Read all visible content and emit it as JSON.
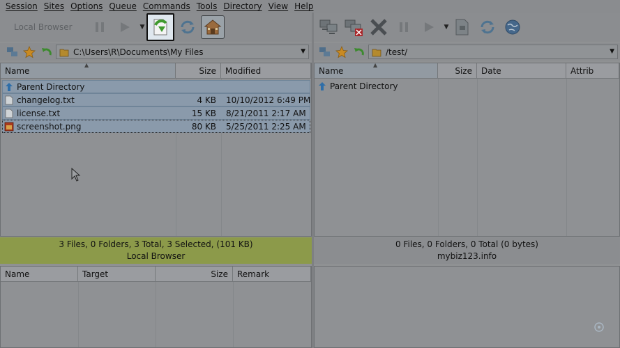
{
  "menu": [
    "Session",
    "Sites",
    "Options",
    "Queue",
    "Commands",
    "Tools",
    "Directory",
    "View",
    "Help"
  ],
  "toolbar": {
    "local_label": "Local Browser"
  },
  "icons": {
    "connect": "connect-icon",
    "disconnect": "disconnect-icon",
    "stop": "stop-icon",
    "pause": "pause-icon",
    "play": "play-icon",
    "download": "download-icon",
    "refresh": "refresh-icon",
    "home": "home-icon",
    "globe": "globe-icon",
    "star": "star-icon",
    "back": "back-arrow-icon",
    "folder": "folder-icon",
    "parent": "parent-directory-icon",
    "text_file": "text-file-icon",
    "image_file": "image-file-icon"
  },
  "local": {
    "path": "C:\\Users\\R\\Documents\\My Files",
    "columns": [
      "Name",
      "Size",
      "Modified"
    ],
    "parent_label": "Parent Directory",
    "files": [
      {
        "name": "changelog.txt",
        "size": "4 KB",
        "modified": "10/10/2012 6:49 PM",
        "kind": "text"
      },
      {
        "name": "license.txt",
        "size": "15 KB",
        "modified": "8/21/2011 2:17 AM",
        "kind": "text"
      },
      {
        "name": "screenshot.png",
        "size": "80 KB",
        "modified": "5/25/2011 2:25 AM",
        "kind": "image"
      }
    ],
    "status_line1": "3 Files, 0 Folders, 3 Total, 3 Selected, (101 KB)",
    "status_line2": "Local Browser"
  },
  "remote": {
    "path": "/test/",
    "columns": [
      "Name",
      "Size",
      "Date",
      "Attrib"
    ],
    "parent_label": "Parent Directory",
    "status_line1": "0 Files, 0 Folders, 0 Total (0 bytes)",
    "status_line2": "mybiz123.info"
  },
  "queue": {
    "columns": [
      "Name",
      "Target",
      "Size",
      "Remark"
    ]
  },
  "colors": {
    "status_local": "#8c9a4a",
    "selection": "#8a9aab",
    "highlight_button": "#dfe7ee"
  }
}
